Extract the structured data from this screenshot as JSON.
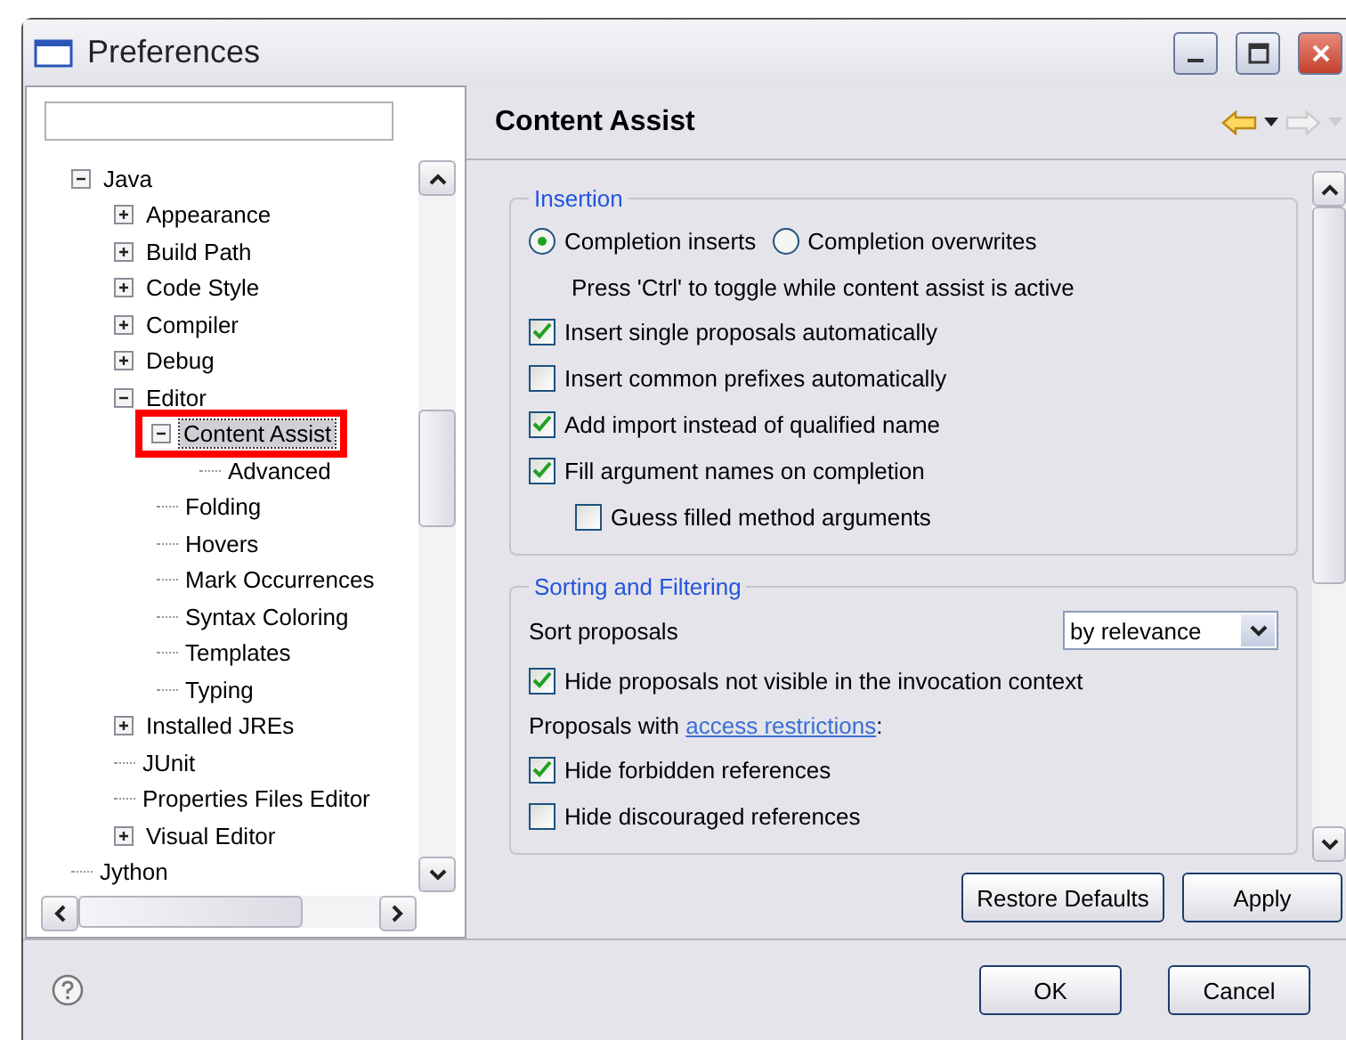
{
  "window": {
    "title": "Preferences"
  },
  "tree": [
    {
      "label": "Java",
      "expanded": true,
      "selected": false,
      "children": [
        {
          "label": "Appearance",
          "expanded": false,
          "selected": false
        },
        {
          "label": "Build Path",
          "expanded": false,
          "selected": false
        },
        {
          "label": "Code Style",
          "expanded": false,
          "selected": false
        },
        {
          "label": "Compiler",
          "expanded": false,
          "selected": false
        },
        {
          "label": "Debug",
          "expanded": false,
          "selected": false
        },
        {
          "label": "Editor",
          "expanded": true,
          "selected": false,
          "children": [
            {
              "label": "Content Assist",
              "expanded": true,
              "selected": true,
              "highlighted": true,
              "children": [
                {
                  "label": "Advanced",
                  "selected": false
                }
              ]
            },
            {
              "label": "Folding",
              "selected": false
            },
            {
              "label": "Hovers",
              "selected": false
            },
            {
              "label": "Mark Occurrences",
              "selected": false
            },
            {
              "label": "Syntax Coloring",
              "selected": false
            },
            {
              "label": "Templates",
              "selected": false
            },
            {
              "label": "Typing",
              "selected": false
            }
          ]
        },
        {
          "label": "Installed JREs",
          "expanded": false,
          "selected": false
        },
        {
          "label": "JUnit",
          "selected": false
        },
        {
          "label": "Properties Files Editor",
          "selected": false
        },
        {
          "label": "Visual Editor",
          "expanded": false,
          "selected": false
        }
      ]
    },
    {
      "label": "Jython",
      "selected": false
    }
  ],
  "page": {
    "title": "Content Assist",
    "back_enabled": true,
    "forward_enabled": false
  },
  "groups": [
    {
      "title": "Insertion",
      "rows": [
        {
          "kind": "radios",
          "options": [
            {
              "label": "Completion inserts",
              "selected": true
            },
            {
              "label": "Completion overwrites",
              "selected": false
            }
          ]
        },
        {
          "kind": "note",
          "text": "Press 'Ctrl' to toggle while content assist is active"
        },
        {
          "kind": "checkbox",
          "label": "Insert single proposals automatically",
          "checked": true
        },
        {
          "kind": "checkbox",
          "label": "Insert common prefixes automatically",
          "checked": false
        },
        {
          "kind": "checkbox",
          "label": "Add import instead of qualified name",
          "checked": true
        },
        {
          "kind": "checkbox",
          "label": "Fill argument names on completion",
          "checked": true
        },
        {
          "kind": "checkbox",
          "label": "Guess filled method arguments",
          "checked": false,
          "indented": true
        }
      ]
    },
    {
      "title": "Sorting and Filtering",
      "rows": [
        {
          "kind": "select",
          "label": "Sort proposals",
          "value": "by relevance"
        },
        {
          "kind": "checkbox",
          "label": "Hide proposals not visible in the invocation context",
          "checked": true
        },
        {
          "kind": "linktext",
          "text": "Proposals with ",
          "link": "access restrictions",
          "after": ":"
        },
        {
          "kind": "checkbox",
          "label": "Hide forbidden references",
          "checked": true
        },
        {
          "kind": "checkbox",
          "label": "Hide discouraged references",
          "checked": false
        }
      ]
    }
  ],
  "page_buttons": {
    "restore": "Restore Defaults",
    "apply": "Apply"
  },
  "dialog_buttons": [
    "OK",
    "Cancel"
  ]
}
